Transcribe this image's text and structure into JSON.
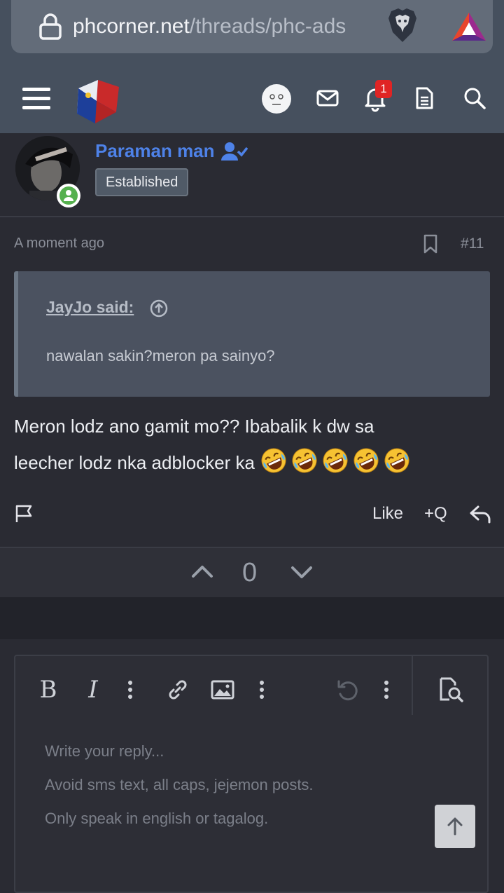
{
  "browser": {
    "url_host": "phcorner.net",
    "url_path": "/threads/phc-ads"
  },
  "header": {
    "notification_count": "1"
  },
  "post": {
    "username": "Paraman man",
    "user_title": "Established",
    "time": "A moment ago",
    "post_number": "#11",
    "quote": {
      "author": "JayJo said:",
      "text": "nawalan sakin?meron pa sainyo?"
    },
    "message_line1": "Meron lodz ano gamit mo?? Ibabalik k dw sa",
    "message_line2": "leecher lodz nka adblocker ka",
    "emoji_count": 5,
    "actions": {
      "like": "Like",
      "quote": "+Q"
    },
    "vote_count": "0"
  },
  "editor": {
    "placeholder": "Write your reply...\nAvoid sms text, all caps, jejemon posts.\nOnly speak in english or tagalog.",
    "bold_label": "B",
    "italic_label": "I"
  },
  "colors": {
    "header_bg": "#46505e",
    "username": "#4e82e8",
    "online": "#55b04e",
    "badge_red": "#e02424"
  },
  "icons": [
    "lock-icon",
    "brave-icon",
    "bat-icon",
    "hamburger-icon",
    "site-logo",
    "avatar-icon",
    "mail-icon",
    "bell-icon",
    "document-icon",
    "search-icon",
    "verified-user-icon",
    "bookmark-icon",
    "arrow-up-circle-icon",
    "rofl-emoji",
    "flag-icon",
    "reply-icon",
    "chevron-up-icon",
    "chevron-down-icon",
    "link-icon",
    "image-icon",
    "undo-icon",
    "more-vertical-icon",
    "preview-icon",
    "arrow-up-icon"
  ]
}
